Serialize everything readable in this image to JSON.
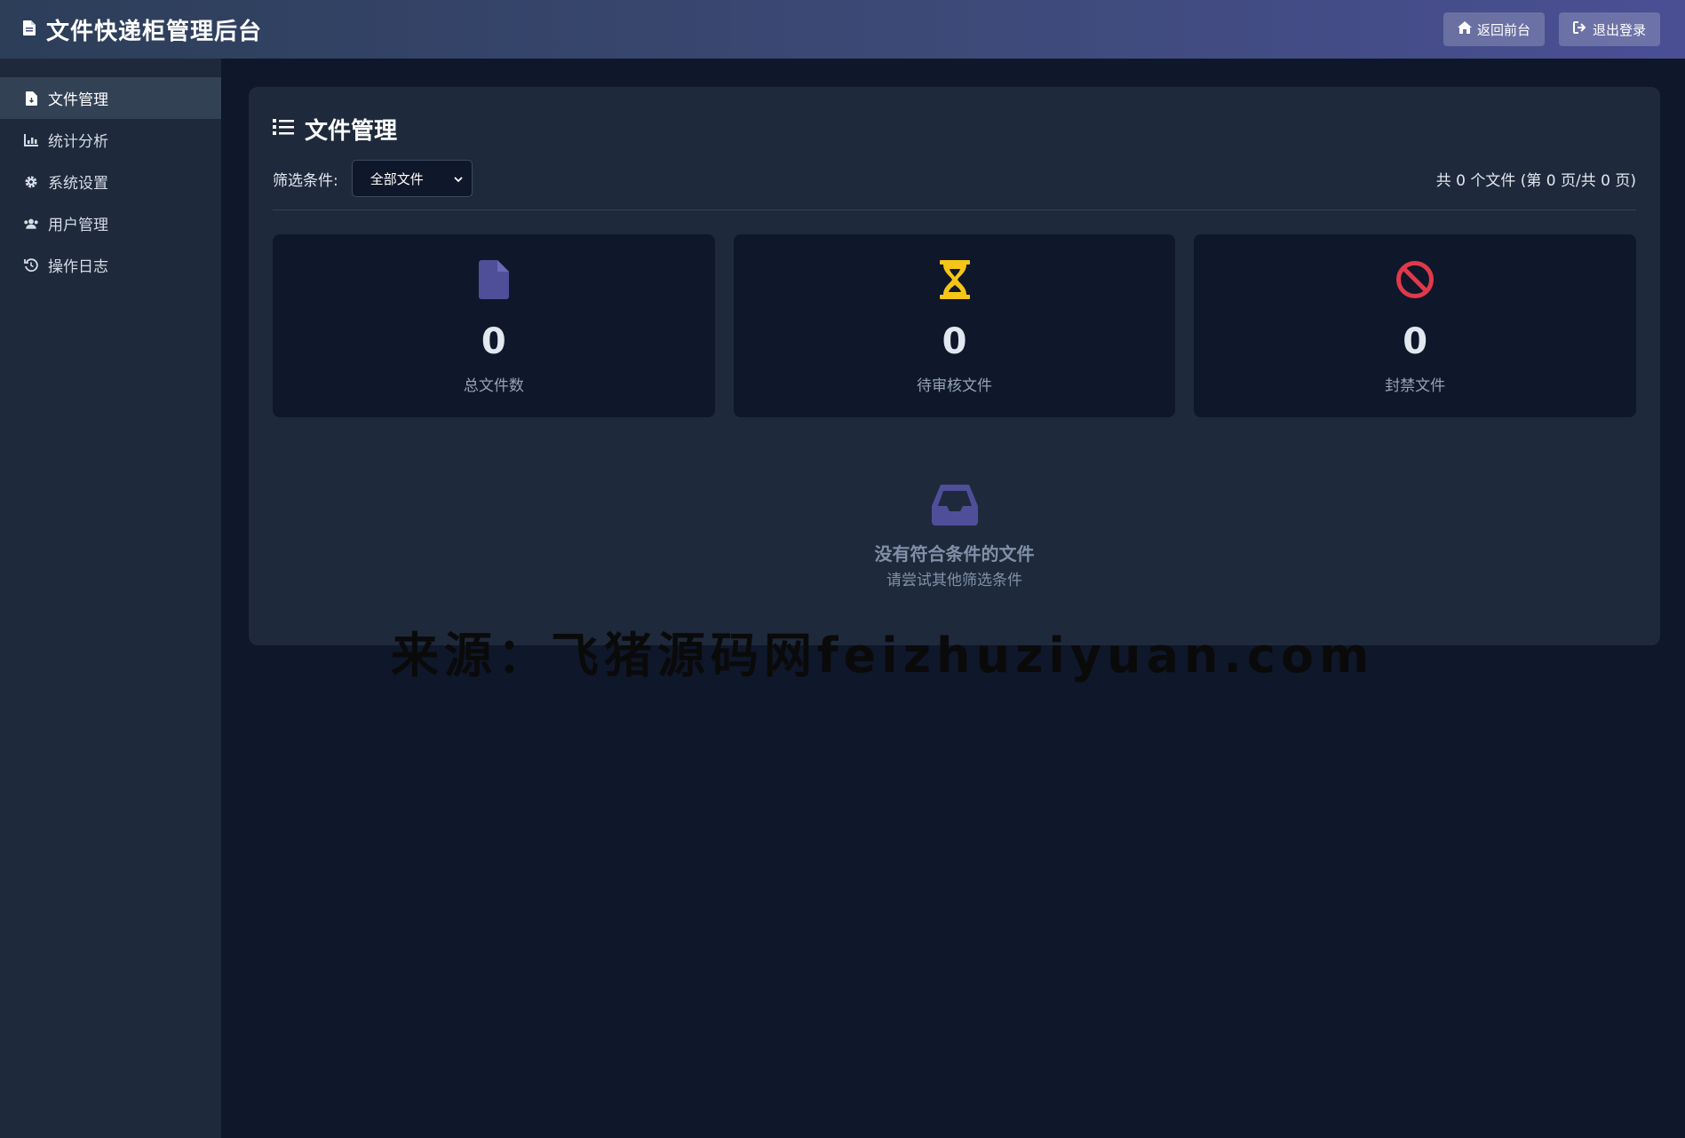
{
  "header": {
    "title": "文件快递柜管理后台",
    "back_label": "返回前台",
    "logout_label": "退出登录"
  },
  "sidebar": {
    "items": [
      {
        "label": "文件管理",
        "icon": "file-icon",
        "active": true
      },
      {
        "label": "统计分析",
        "icon": "chart-icon",
        "active": false
      },
      {
        "label": "系统设置",
        "icon": "gear-icon",
        "active": false
      },
      {
        "label": "用户管理",
        "icon": "users-icon",
        "active": false
      },
      {
        "label": "操作日志",
        "icon": "history-icon",
        "active": false
      }
    ]
  },
  "main": {
    "title": "文件管理",
    "filter_label": "筛选条件:",
    "filter_value": "全部文件",
    "count_text": "共 0 个文件 (第 0 页/共 0 页)",
    "stats": [
      {
        "value": "0",
        "label": "总文件数",
        "icon": "file-icon",
        "color": "#4f4f99"
      },
      {
        "value": "0",
        "label": "待审核文件",
        "icon": "hourglass-icon",
        "color": "#f5c518"
      },
      {
        "value": "0",
        "label": "封禁文件",
        "icon": "ban-icon",
        "color": "#e0394a"
      }
    ],
    "empty_icon": "inbox-icon",
    "empty_title": "没有符合条件的文件",
    "empty_subtitle": "请尝试其他筛选条件"
  },
  "watermark": "来源：飞猪源码网feizhuziyuan.com",
  "colors": {
    "background": "#0f172a",
    "panel": "#1e293b",
    "accent": "#4f4f99"
  }
}
